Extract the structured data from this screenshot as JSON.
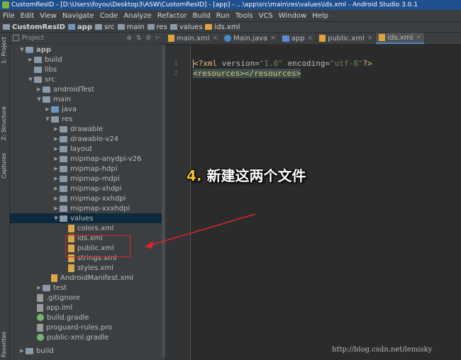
{
  "window": {
    "title": "CustomResID - [D:\\Users\\foyou\\Desktop3\\ASW\\CustomResID] - [app] - ...\\app\\src\\main\\res\\values\\ids.xml - Android Studio 3.0.1"
  },
  "menu": [
    "File",
    "Edit",
    "View",
    "Navigate",
    "Code",
    "Analyze",
    "Refactor",
    "Build",
    "Run",
    "Tools",
    "VCS",
    "Window",
    "Help"
  ],
  "breadcrumb": [
    "CustomResID",
    "app",
    "src",
    "main",
    "res",
    "values",
    "ids.xml"
  ],
  "side_tabs": {
    "project": "1: Project",
    "structure": "Z: Structure",
    "captures": "Captures",
    "favorites": "Favorites"
  },
  "project_panel": {
    "title": "Project"
  },
  "tree": [
    {
      "label": "app",
      "icon": "module-folder",
      "expanded": true
    },
    {
      "label": "build",
      "icon": "folder",
      "expanded": false
    },
    {
      "label": "libs",
      "icon": "folder",
      "expanded": null
    },
    {
      "label": "src",
      "icon": "folder",
      "expanded": true
    },
    {
      "label": "androidTest",
      "icon": "folder",
      "expanded": false
    },
    {
      "label": "main",
      "icon": "folder",
      "expanded": true
    },
    {
      "label": "java",
      "icon": "source-folder",
      "expanded": false
    },
    {
      "label": "res",
      "icon": "folder",
      "expanded": true
    },
    {
      "label": "drawable",
      "icon": "folder",
      "expanded": false
    },
    {
      "label": "drawable-v24",
      "icon": "folder",
      "expanded": false
    },
    {
      "label": "layout",
      "icon": "folder",
      "expanded": false
    },
    {
      "label": "mipmap-anydpi-v26",
      "icon": "folder",
      "expanded": false
    },
    {
      "label": "mipmap-hdpi",
      "icon": "folder",
      "expanded": false
    },
    {
      "label": "mipmap-mdpi",
      "icon": "folder",
      "expanded": false
    },
    {
      "label": "mipmap-xhdpi",
      "icon": "folder",
      "expanded": false
    },
    {
      "label": "mipmap-xxhdpi",
      "icon": "folder",
      "expanded": false
    },
    {
      "label": "mipmap-xxxhdpi",
      "icon": "folder",
      "expanded": false
    },
    {
      "label": "values",
      "icon": "folder",
      "expanded": true,
      "selected": true
    },
    {
      "label": "colors.xml",
      "icon": "xml-file"
    },
    {
      "label": "ids.xml",
      "icon": "xml-file"
    },
    {
      "label": "public.xml",
      "icon": "xml-file"
    },
    {
      "label": "strings.xml",
      "icon": "xml-file"
    },
    {
      "label": "styles.xml",
      "icon": "xml-file"
    },
    {
      "label": "AndroidManifest.xml",
      "icon": "xml-file"
    },
    {
      "label": "test",
      "icon": "folder",
      "expanded": false
    },
    {
      "label": ".gitignore",
      "icon": "text-file"
    },
    {
      "label": "app.iml",
      "icon": "text-file"
    },
    {
      "label": "build.gradle",
      "icon": "gradle-file"
    },
    {
      "label": "proguard-rules.pro",
      "icon": "text-file"
    },
    {
      "label": "public-xml.gradle",
      "icon": "gradle-file"
    },
    {
      "label": "build",
      "icon": "folder",
      "expanded": false
    }
  ],
  "tabs": [
    {
      "label": "main.xml",
      "icon": "xml-file-icon",
      "active": false
    },
    {
      "label": "Main.java",
      "icon": "java-class-icon",
      "active": false
    },
    {
      "label": "app",
      "icon": "module-icon",
      "active": false
    },
    {
      "label": "public.xml",
      "icon": "xml-file-icon",
      "active": false
    },
    {
      "label": "ids.xml",
      "icon": "xml-file-icon",
      "active": true
    }
  ],
  "editor": {
    "line_numbers": [
      "1",
      "2"
    ],
    "line1": {
      "pi_open": "<?xml",
      "attr1": " version=",
      "val1": "\"1.0\"",
      "attr2": " encoding=",
      "val2": "\"utf-8\"",
      "pi_close": "?>"
    },
    "line2": {
      "text": "<resources></resources>"
    }
  },
  "annotation": {
    "number": "4.",
    "text": " 新建这两个文件"
  },
  "watermark": "http://blog.csdn.net/lemisky",
  "colors": {
    "annotation_box": "#e0242a",
    "annotation_arrow": "#e0242a",
    "selection": "#0d293e",
    "titlebar": "#1f4f8f"
  }
}
